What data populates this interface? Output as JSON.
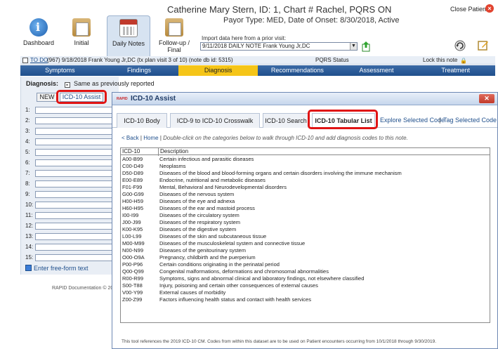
{
  "header": {
    "title": "Catherine Mary Stern, ID: 1, Chart # Rachel, PQRS ON",
    "subtitle": "Payor Type: MED, Date of Onset: 8/30/2018, Active",
    "close_patient": "Close Patient",
    "import_label": "Import data here from a prior visit:",
    "import_value": "9/11/2018 DAILY NOTE Frank Young Jr,DC"
  },
  "toolbar": {
    "items": [
      {
        "label": "Dashboard",
        "icon": "info-icon"
      },
      {
        "label": "Initial",
        "icon": "clipboard-icon"
      },
      {
        "label": "Daily Notes",
        "icon": "calendar-icon"
      },
      {
        "label": "Follow-up / Final",
        "icon": "clipboard-check-icon"
      }
    ]
  },
  "patient_bar": {
    "todo": "TO DO",
    "visit_info": "(967) 9/18/2018 Frank Young Jr,DC (tx plan visit 3 of 10) (note db id: 5315)",
    "pqrs_status": "PQRS Status",
    "lock_note": "Lock this note"
  },
  "nav_tabs": [
    "Symptoms",
    "Findings",
    "Diagnosis",
    "Recommendations",
    "Assessment",
    "Treatment"
  ],
  "diagnosis": {
    "label": "Diagnosis:",
    "same_as_previous": "Same as previously reported",
    "sub_tabs": [
      "NEW",
      "ICD-10 Assist"
    ],
    "code_rows": [
      "1:",
      "2:",
      "3:",
      "4:",
      "5:",
      "6:",
      "7:",
      "8:",
      "9:",
      "10:",
      "11:",
      "12:",
      "13:",
      "14:",
      "15:"
    ],
    "free_form": "Enter free-form text",
    "footer": "RAPID Documentation © 200"
  },
  "modal": {
    "title": "ICD-10 Assist",
    "logo": "RAPID",
    "tabs": [
      "ICD-10 Body",
      "ICD-9 to ICD-10 Crosswalk",
      "ICD-10 Search",
      "ICD-10 Tabular List"
    ],
    "links": [
      "Explore Selected Code",
      "Tag Selected Code"
    ],
    "link_sep": "|",
    "breadcrumb_back": "< Back",
    "breadcrumb_home": "Home",
    "breadcrumb_sep": "|",
    "instruction": "Double-click on the categories below to walk through ICD-10 and add diagnosis codes to this note.",
    "col_code": "ICD-10",
    "col_desc": "Description",
    "rows": [
      {
        "code": "A00-B99",
        "desc": "Certain infectious and parasitic diseases"
      },
      {
        "code": "C00-D49",
        "desc": "Neoplasms"
      },
      {
        "code": "D50-D89",
        "desc": "Diseases of the blood and blood-forming organs and certain disorders involving the immune mechanism"
      },
      {
        "code": "E00-E89",
        "desc": "Endocrine, nutritional and metabolic diseases"
      },
      {
        "code": "F01-F99",
        "desc": "Mental, Behavioral and Neurodevelopmental disorders"
      },
      {
        "code": "G00-G99",
        "desc": "Diseases of the nervous system"
      },
      {
        "code": "H00-H59",
        "desc": "Diseases of the eye and adnexa"
      },
      {
        "code": "H60-H95",
        "desc": "Diseases of the ear and mastoid process"
      },
      {
        "code": "I00-I99",
        "desc": "Diseases of the circulatory system"
      },
      {
        "code": "J00-J99",
        "desc": "Diseases of the respiratory system"
      },
      {
        "code": "K00-K95",
        "desc": "Diseases of the digestive system"
      },
      {
        "code": "L00-L99",
        "desc": "Diseases of the skin and subcutaneous tissue"
      },
      {
        "code": "M00-M99",
        "desc": "Diseases of the musculoskeletal system and connective tissue"
      },
      {
        "code": "N00-N99",
        "desc": "Diseases of the genitourinary system"
      },
      {
        "code": "O00-O9A",
        "desc": "Pregnancy, childbirth and the puerperium"
      },
      {
        "code": "P00-P96",
        "desc": "Certain conditions originating in the perinatal period"
      },
      {
        "code": "Q00-Q99",
        "desc": "Congenital malformations, deformations and chromosomal abnormalities"
      },
      {
        "code": "R00-R99",
        "desc": "Symptoms, signs and abnormal clinical and laboratory findings, not elsewhere classified"
      },
      {
        "code": "S00-T88",
        "desc": "Injury, poisoning and certain other consequences of external causes"
      },
      {
        "code": "V00-Y99",
        "desc": "External causes of morbidity"
      },
      {
        "code": "Z00-Z99",
        "desc": "Factors influencing health status and contact with health services"
      }
    ],
    "footer": "This tool references the 2019 ICD-10 CM. Codes from within this dataset are to be used on Patient encounters occurring from 10/1/2018 through 9/30/2019."
  },
  "colors": {
    "nav_blue": "#1f4f8c",
    "active_tab": "#f5c518",
    "highlight_red": "#e01414"
  }
}
